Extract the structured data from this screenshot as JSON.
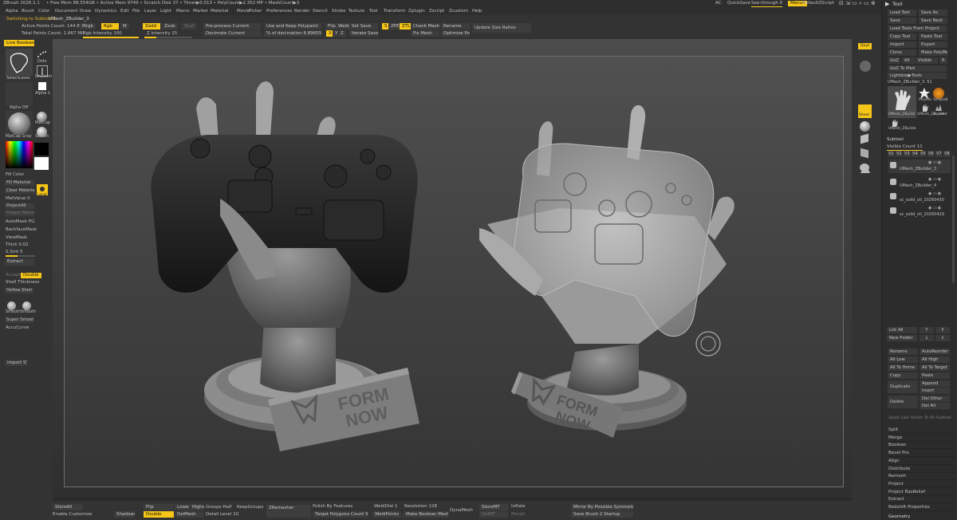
{
  "titlebar": {
    "app_title": "ZBrush 2026.1.1",
    "stats": "• Free Mem 88.554GB • Active Mem 9749 • Scratch Disk 37 • Timer▶0.013 • PolyCount▶2.352 MP • MeshCount▶3",
    "ac": "AC",
    "quicksave": "QuickSave",
    "see_through": "See-through 0",
    "menus": "Menus",
    "default_zscript": "DefaultZScript"
  },
  "menus": [
    "Alpha",
    "Brush",
    "Color",
    "Document",
    "Draw",
    "Dynamics",
    "Edit",
    "File",
    "Layer",
    "Light",
    "Macro",
    "Marker",
    "Material",
    "Movie",
    "Picker",
    "Preferences",
    "Render",
    "Stencil",
    "Stroke",
    "Texture",
    "Tool",
    "Transform",
    "Zplugin",
    "Zscript",
    "Zcustom",
    "Help"
  ],
  "toolshelf": {
    "switching": "Switching to Subtool 1",
    "mesh_name": "UMesh_ZBuilder_3",
    "active_points": "Active Points Count: 144.864",
    "total_points": "Total Points Count: 1.867 Mil",
    "mrgb": "Mrgb",
    "rgb": "Rgb",
    "m": "M",
    "zadd": "Zadd",
    "zsub": "Zsub",
    "zcut": "Zcut",
    "rgb_intensity": "Rgb Intensity 100",
    "z_intensity": "Z Intensity 25",
    "preprocess": "Pre-process Current",
    "decimate": "Decimate Current",
    "use_keep": "Use and Keep Polypaint",
    "pct_decimation": "% of decimation 6.89655",
    "flip": "Flip",
    "weld": "Weld",
    "set_save": "Set Save",
    "s": "S",
    "zpe": "ZPE",
    "ztl": "ZTL",
    "x": "X",
    "y": "Y",
    "z": "Z",
    "iterate_save": "Iterate Save",
    "check_mesh": "Check Mesh Int",
    "fix_mesh": "Fix Mesh",
    "rename": "Rename",
    "optimize_points": "Optimize Points",
    "update_size": "Update Size Ratios"
  },
  "left": {
    "live_boolean": "Live Boolean",
    "dots": "Dots",
    "selectlasso": "SelectLasso",
    "alpha_off": "Alpha Off",
    "alpha_1": "Alpha 1",
    "unzoom": "UnZoom",
    "matcap_gray": "MatCap Gray",
    "matcap": "MatCap",
    "skinsh": "SkinSh",
    "fill_color": "Fill Color",
    "fill_material": "Fill Material",
    "clear_material": "Clear Material",
    "metvalue": "MetValue 0",
    "projectall": "ProjectAll",
    "project_history": "Project History",
    "automask": "AutoMask PG",
    "backfacemask": "BackfaceMask",
    "viewmask": "ViewMask",
    "thick": "Thick 0.02",
    "smt": "S.Smt 5",
    "extract": "Extract",
    "accept": "Accept",
    "double": "Double",
    "shell_thickness": "Shell Thickness",
    "hollow": "Hollow",
    "shell": "Shell",
    "smooth1": "Smooth",
    "smooth2": "Smooth",
    "super_smooth": "Super Smooth",
    "accucurve": "AccuCurve",
    "import_stl": "Import STL",
    "local": "Local"
  },
  "rightshelf": {
    "xyz": "Qxyz",
    "sheet": "Sheet"
  },
  "scene": {
    "logo_line1": "FORM",
    "logo_line2": "NOW"
  },
  "tray": {
    "title": "Tool",
    "buttons": [
      [
        "Load Tool",
        "Save As"
      ],
      [
        "Save",
        "Save Next"
      ],
      [
        "Load Tools From Project",
        ""
      ],
      [
        "Copy Tool",
        "Paste Tool"
      ],
      [
        "Import",
        "Export"
      ],
      [
        "Clone",
        "Make PolyMesh3D"
      ],
      [
        "GoZ",
        "All",
        "Visible",
        "R"
      ],
      [
        "GoZ To iPad",
        ""
      ],
      [
        "Lightbox▶Tools",
        ""
      ]
    ],
    "tool_name": "UMesh_ZBuilder_3. 51",
    "tool_labels": [
      "UMesh_ZBuildr",
      "PolyMe",
      "SimpleB",
      "UMesh_ZBuilde",
      "sc_solid",
      "UMesh_ZBuilde"
    ],
    "subtool_header": "Subtool",
    "visible_count": "Visible Count 11",
    "v_labels": [
      "V1",
      "V2",
      "V3",
      "V4",
      "V5",
      "V6",
      "V7",
      "V8"
    ],
    "subtools": [
      "UMesh_ZBuilder_3",
      "UMesh_ZBuilder_4",
      "sc_solid_stl_20260430",
      "sc_solid_stl_20260429"
    ],
    "list_all": "List All",
    "new_folder": "New Folder",
    "ops": [
      [
        "Rename",
        "AutoReorder"
      ],
      [
        "All Low",
        "All High"
      ],
      [
        "All To Home",
        "All To Target"
      ],
      [
        "Copy",
        "Paste"
      ],
      [
        "Duplicate",
        "Append"
      ],
      [
        "",
        "Insert"
      ],
      [
        "Delete",
        "Del Other"
      ],
      [
        "",
        "Del All"
      ]
    ],
    "apply_last": "Apply Last Action To All Subtool",
    "sections": [
      "Split",
      "Merge",
      "Boolean",
      "Bevel Pro",
      "Align",
      "Distribute",
      "Remesh",
      "Project",
      "Project BasRelief",
      "Extract",
      "Redshift Properties"
    ],
    "geometry": "Geometry"
  },
  "bottom": {
    "storeall": "StoreAll",
    "enable_customize": "Enable Customize",
    "shadows": "Shadows",
    "flip": "Flip",
    "double": "Double",
    "lower": "Lower",
    "higher": "Higher",
    "groups_half": "Groups Half",
    "keepgroups": "KeepGroups",
    "delmesh": "DelMesh",
    "detail_level": "Detail Level 10",
    "zremesher": "ZRemesher",
    "polish": "Polish By Features",
    "target_polygons": "Target Polygons Count 5",
    "weldoist": "WeldDist 1",
    "weldpoints": "WeldPoints",
    "resolution": "Resolution 128",
    "make_boolean": "Make Boolean Mesh",
    "dynamesh": "DynaMesh",
    "storemt": "StoreMT",
    "delmt": "DelMT",
    "inflate": "Inflate",
    "morph": "Morph",
    "mirror": "Mirror By Possible Symmetry",
    "save_brush": "Save Brush 2 Startup"
  },
  "colors": {
    "accent": "#f5c518",
    "panel": "#333333",
    "canvas_top": "#505050",
    "canvas_bottom": "#353535"
  }
}
